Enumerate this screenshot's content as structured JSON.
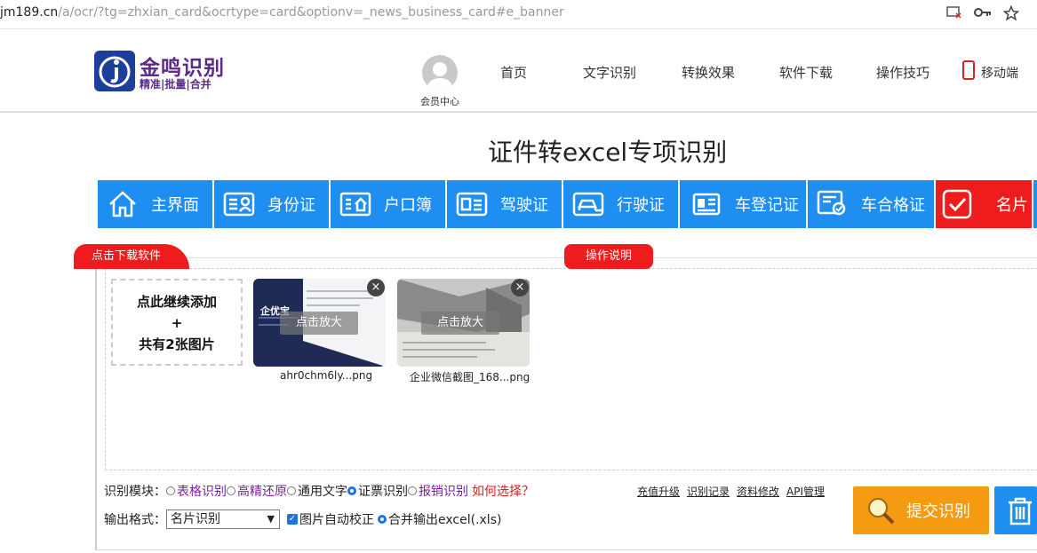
{
  "browser": {
    "url_host": "jm189.cn",
    "url_path": "/a/ocr/?tg=zhxian_card&ocrtype=card&optionv=_news_business_card#e_banner",
    "icons": [
      "tab-close-icon",
      "key-icon",
      "star-icon"
    ]
  },
  "header": {
    "logo_title": "金鸣识别",
    "logo_sub": "精准|批量|合并",
    "member_label": "会员中心",
    "nav": [
      "首页",
      "文字识别",
      "转换效果",
      "软件下载",
      "操作技巧"
    ],
    "mobile_label": "移动端"
  },
  "page_title": "证件转excel专项识别",
  "tabs": [
    {
      "label": "主界面",
      "icon": "home-icon",
      "active": false
    },
    {
      "label": "身份证",
      "icon": "id-card-icon",
      "active": false
    },
    {
      "label": "户口簿",
      "icon": "household-icon",
      "active": false
    },
    {
      "label": "驾驶证",
      "icon": "driver-license-icon",
      "active": false
    },
    {
      "label": "行驶证",
      "icon": "vehicle-license-icon",
      "active": false
    },
    {
      "label": "车登记证",
      "icon": "registration-icon",
      "active": false
    },
    {
      "label": "车合格证",
      "icon": "certificate-icon",
      "active": false
    },
    {
      "label": "名片",
      "icon": "check-icon",
      "active": true
    }
  ],
  "download_tag": "点击下载软件",
  "instructions_tag": "操作说明",
  "upload": {
    "add_line1": "点此继续添加",
    "add_line2": "+",
    "add_line3": "共有2张图片",
    "zoom_label": "点击放大",
    "files": [
      {
        "name": "ahr0chm6ly...png",
        "card_title": "企优宝"
      },
      {
        "name": "企业微信截图_168...png"
      }
    ]
  },
  "options": {
    "module_label": "识别模块：",
    "modules": [
      {
        "label": "表格识别",
        "checked": false
      },
      {
        "label": "高精还原",
        "checked": false
      },
      {
        "label": "通用文字",
        "checked": false
      },
      {
        "label": "证票识别",
        "checked": true
      },
      {
        "label": "报销识别",
        "checked": false
      }
    ],
    "how_to_choose": "如何选择？",
    "links": [
      "充值升级",
      "识别记录",
      "资料修改",
      "API管理"
    ],
    "format_label": "输出格式：",
    "format_value": "名片识别",
    "auto_correct": "图片自动校正",
    "merge_output": "合并输出excel(.xls)"
  },
  "submit_label": "提交识别",
  "colors": {
    "blue": "#1e8ef0",
    "red": "#ee1c1c",
    "orange": "#f59b12",
    "purple": "#7a1fa0"
  }
}
